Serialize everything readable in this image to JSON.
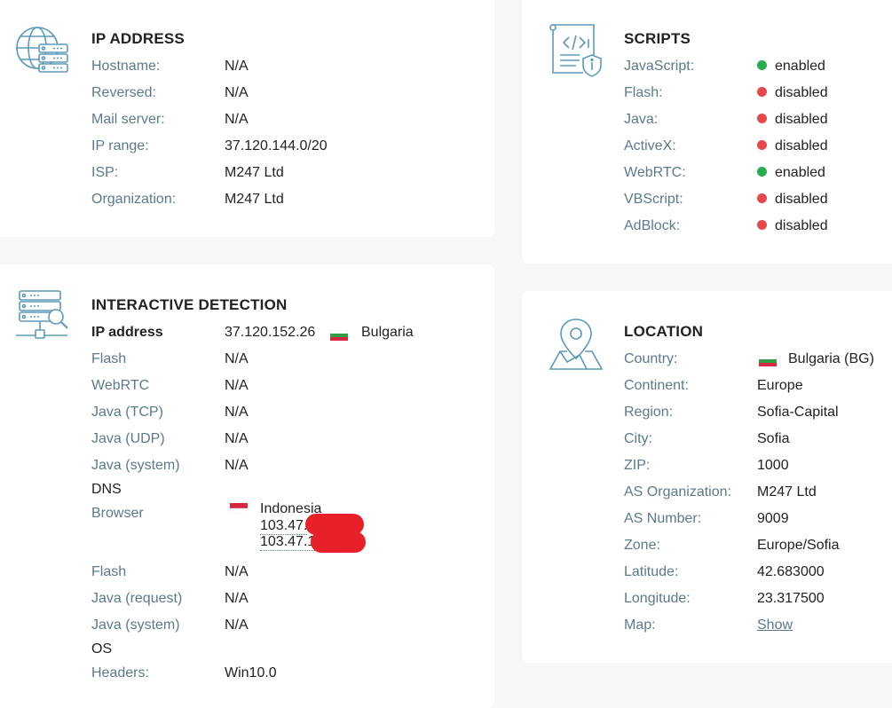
{
  "ip_address": {
    "title": "IP ADDRESS",
    "rows": [
      {
        "label": "Hostname:",
        "value": "N/A"
      },
      {
        "label": "Reversed:",
        "value": "N/A"
      },
      {
        "label": "Mail server:",
        "value": "N/A"
      },
      {
        "label": "IP range:",
        "value": "37.120.144.0/20"
      },
      {
        "label": "ISP:",
        "value": "M247 Ltd"
      },
      {
        "label": "Organization:",
        "value": "M247 Ltd"
      }
    ]
  },
  "scripts": {
    "title": "SCRIPTS",
    "rows": [
      {
        "label": "JavaScript:",
        "value": "enabled",
        "status_color": "#27ae4f"
      },
      {
        "label": "Flash:",
        "value": "disabled",
        "status_color": "#e5484d"
      },
      {
        "label": "Java:",
        "value": "disabled",
        "status_color": "#e5484d"
      },
      {
        "label": "ActiveX:",
        "value": "disabled",
        "status_color": "#e5484d"
      },
      {
        "label": "WebRTC:",
        "value": "enabled",
        "status_color": "#27ae4f"
      },
      {
        "label": "VBScript:",
        "value": "disabled",
        "status_color": "#e5484d"
      },
      {
        "label": "AdBlock:",
        "value": "disabled",
        "status_color": "#e5484d"
      }
    ]
  },
  "interactive": {
    "title": "INTERACTIVE DETECTION",
    "ip_label": "IP address",
    "ip_value": "37.120.152.26",
    "ip_country": "Bulgaria",
    "flash_label": "Flash",
    "flash_value": "N/A",
    "webrtc_label": "WebRTC",
    "webrtc_value": "N/A",
    "java_tcp_label": "Java (TCP)",
    "java_tcp_value": "N/A",
    "java_udp_label": "Java (UDP)",
    "java_udp_value": "N/A",
    "java_system_label": "Java (system)",
    "java_system_value": "N/A",
    "dns_heading": "DNS",
    "browser_label": "Browser",
    "browser_country": "Indonesia",
    "browser_ip_1": "103.47.",
    "browser_ip_2": "103.47.1",
    "flash2_label": "Flash",
    "flash2_value": "N/A",
    "java_request_label": "Java (request)",
    "java_request_value": "N/A",
    "java_system2_label": "Java (system)",
    "java_system2_value": "N/A",
    "os_heading": "OS",
    "headers_label": "Headers:",
    "headers_value": "Win10.0"
  },
  "location": {
    "title": "LOCATION",
    "country_label": "Country:",
    "country_value": "Bulgaria (BG)",
    "rows": [
      {
        "label": "Continent:",
        "value": "Europe"
      },
      {
        "label": "Region:",
        "value": "Sofia-Capital"
      },
      {
        "label": "City:",
        "value": "Sofia"
      },
      {
        "label": "ZIP:",
        "value": "1000"
      },
      {
        "label": "AS Organization:",
        "value": "M247 Ltd"
      },
      {
        "label": "AS Number:",
        "value": "9009"
      },
      {
        "label": "Zone:",
        "value": "Europe/Sofia"
      },
      {
        "label": "Latitude:",
        "value": "42.683000"
      },
      {
        "label": "Longitude:",
        "value": "23.317500"
      }
    ],
    "map_label": "Map:",
    "map_link": "Show"
  },
  "colors": {
    "label": "#5b7a8c",
    "icon": "#5b9ab8",
    "enabled": "#27ae4f",
    "disabled": "#e5484d",
    "redaction": "#e8202a"
  },
  "icons": {
    "ip_address": "globe-server-icon",
    "scripts": "script-shield-icon",
    "interactive": "server-search-icon",
    "location": "map-pin-icon"
  }
}
